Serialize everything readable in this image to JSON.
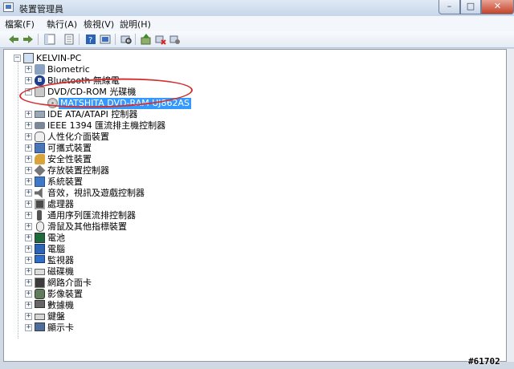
{
  "window": {
    "title": "裝置管理員",
    "controls": {
      "minimize": "–",
      "maximize": "□",
      "close": "✕"
    }
  },
  "menu": [
    "檔案(F)",
    "執行(A)",
    "檢視(V)",
    "說明(H)"
  ],
  "toolbar": {
    "icons": [
      "back-arrow-icon",
      "forward-arrow-icon",
      "show-hide-tree-icon",
      "properties-icon",
      "help-icon",
      "show-hidden-icon",
      "scan-hardware-icon",
      "update-driver-icon",
      "disable-device-icon",
      "uninstall-icon"
    ]
  },
  "tree": {
    "root": "KELVIN-PC",
    "items": [
      {
        "label": "Biometric",
        "icon": "biometric-icon",
        "expander": "+"
      },
      {
        "label": "Bluetooth 無線電",
        "icon": "bluetooth-icon",
        "expander": "+"
      },
      {
        "label": "DVD/CD-ROM 光碟機",
        "icon": "dvd-drive-icon",
        "expander": "−",
        "children": [
          {
            "label": "MATSHITA DVD-RAM UJ862AS",
            "icon": "disc-icon",
            "selected": true
          }
        ]
      },
      {
        "label": "IDE ATA/ATAPI 控制器",
        "icon": "ide-controller-icon",
        "expander": "+"
      },
      {
        "label": "IEEE 1394 匯流排主機控制器",
        "icon": "ieee1394-icon",
        "expander": "+"
      },
      {
        "label": "人性化介面裝置",
        "icon": "hid-icon",
        "expander": "+"
      },
      {
        "label": "可攜式裝置",
        "icon": "portable-device-icon",
        "expander": "+"
      },
      {
        "label": "安全性裝置",
        "icon": "security-key-icon",
        "expander": "+"
      },
      {
        "label": "存放裝置控制器",
        "icon": "storage-controller-icon",
        "expander": "+"
      },
      {
        "label": "系統裝置",
        "icon": "system-device-icon",
        "expander": "+"
      },
      {
        "label": "音效，視訊及遊戲控制器",
        "icon": "sound-icon",
        "expander": "+"
      },
      {
        "label": "處理器",
        "icon": "processor-icon",
        "expander": "+"
      },
      {
        "label": "通用序列匯流排控制器",
        "icon": "usb-icon",
        "expander": "+"
      },
      {
        "label": "滑鼠及其他指標裝置",
        "icon": "mouse-icon",
        "expander": "+"
      },
      {
        "label": "電池",
        "icon": "battery-icon",
        "expander": "+"
      },
      {
        "label": "電腦",
        "icon": "computer-icon",
        "expander": "+"
      },
      {
        "label": "監視器",
        "icon": "monitor-icon",
        "expander": "+"
      },
      {
        "label": "磁碟機",
        "icon": "disk-drive-icon",
        "expander": "+"
      },
      {
        "label": "網路介面卡",
        "icon": "network-adapter-icon",
        "expander": "+"
      },
      {
        "label": "影像裝置",
        "icon": "imaging-device-icon",
        "expander": "+"
      },
      {
        "label": "數據機",
        "icon": "modem-icon",
        "expander": "+"
      },
      {
        "label": "鍵盤",
        "icon": "keyboard-icon",
        "expander": "+"
      },
      {
        "label": "顯示卡",
        "icon": "display-adapter-icon",
        "expander": "+"
      }
    ]
  },
  "watermark": "#61702",
  "colors": {
    "selection": "#3399ff",
    "annotation": "#d23030"
  }
}
